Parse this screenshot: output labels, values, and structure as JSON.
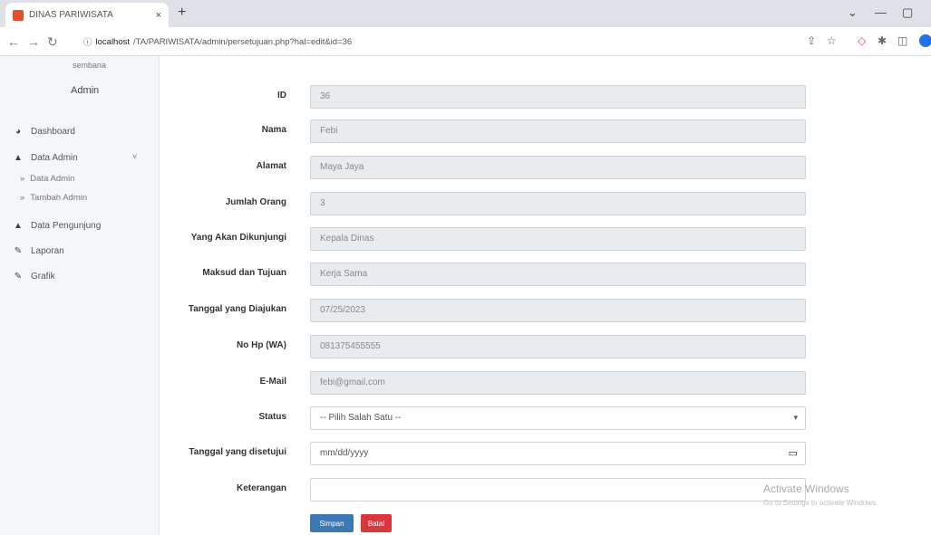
{
  "browser": {
    "tab_title": "DINAS PARIWISATA",
    "tab_close": "×",
    "new_tab": "+",
    "url_host": "localhost",
    "url_path": "/TA/PARIWISATA/admin/persetujuan.php?hal=edit&id=36",
    "window": {
      "minimize": "—",
      "maximize": "▢",
      "dropdown": "⌄"
    }
  },
  "sidebar": {
    "user_sub": "sembana",
    "user_name": "Admin",
    "items": [
      {
        "label": "Dashboard",
        "icon": "dashboard-icon"
      },
      {
        "label": "Data Admin",
        "icon": "user-icon"
      },
      {
        "label": "Data Pengunjung",
        "icon": "user-icon"
      },
      {
        "label": "Laporan",
        "icon": "pen-icon"
      },
      {
        "label": "Grafik",
        "icon": "pen-icon"
      }
    ],
    "sub_items": [
      {
        "label": "Data Admin"
      },
      {
        "label": "Tambah Admin"
      }
    ]
  },
  "form": {
    "rows": [
      {
        "label": "ID",
        "value": "36"
      },
      {
        "label": "Nama",
        "value": "Febi"
      },
      {
        "label": "Alamat",
        "value": "Maya Jaya"
      },
      {
        "label": "Jumlah Orang",
        "value": "3"
      },
      {
        "label": "Yang Akan Dikunjungi",
        "value": "Kepala Dinas"
      },
      {
        "label": "Maksud dan Tujuan",
        "value": "Kerja Sama"
      },
      {
        "label": "Tanggal yang Diajukan",
        "value": "07/25/2023"
      },
      {
        "label": "No Hp (WA)",
        "value": "081375455555"
      },
      {
        "label": "E-Mail",
        "value": "febi@gmail.com"
      }
    ],
    "status_label": "Status",
    "status_value": "-- Pilih Salah Satu --",
    "approved_label": "Tanggal yang disetujui",
    "approved_placeholder": "mm/dd/yyyy",
    "note_label": "Keterangan",
    "note_value": "",
    "save_label": "Simpan",
    "back_label": "Batal"
  },
  "overlay": {
    "activate_title": "Activate Windows",
    "activate_sub": "Go to Settings to activate Windows."
  }
}
